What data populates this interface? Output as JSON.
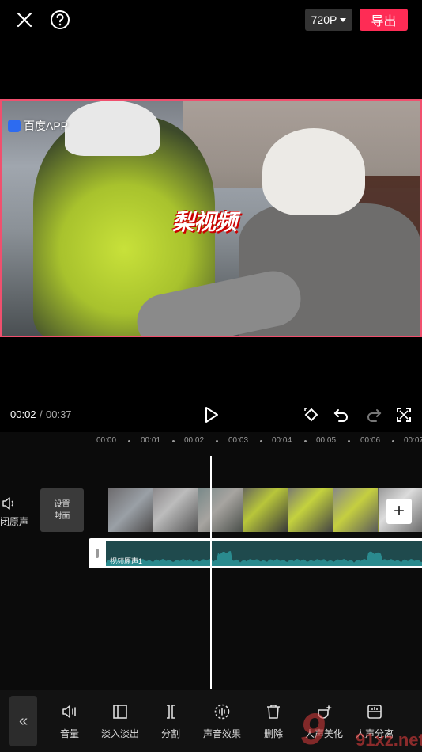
{
  "topbar": {
    "resolution": "720P",
    "export_label": "导出",
    "close_icon": "close-icon",
    "help_icon": "help-icon"
  },
  "preview": {
    "watermark_left": "百度APP",
    "watermark_center": "梨视频"
  },
  "playback": {
    "current_time": "00:02",
    "separator": "/",
    "total_time": "00:37"
  },
  "timeline": {
    "ticks": [
      "00:00",
      "00:01",
      "00:02",
      "00:03",
      "00:04",
      "00:05",
      "00:06",
      "00:07"
    ],
    "mute_label": "闭原声",
    "cover_line1": "设置",
    "cover_line2": "封面",
    "audio_label": "视频原声1"
  },
  "toolbar": {
    "items": [
      {
        "label": "音量",
        "icon": "volume-icon"
      },
      {
        "label": "淡入淡出",
        "icon": "fade-icon"
      },
      {
        "label": "分割",
        "icon": "split-icon"
      },
      {
        "label": "声音效果",
        "icon": "sound-effect-icon"
      },
      {
        "label": "删除",
        "icon": "delete-icon"
      },
      {
        "label": "人声美化",
        "icon": "voice-beautify-icon"
      },
      {
        "label": "人声分离",
        "icon": "voice-separate-icon"
      }
    ],
    "collapse_label": "«"
  },
  "site_watermark": {
    "big": "9",
    "small": "91xz.net"
  },
  "colors": {
    "accent": "#fe2c55",
    "audio_track": "#1f4a4d",
    "waveform": "#2a8a8e"
  }
}
